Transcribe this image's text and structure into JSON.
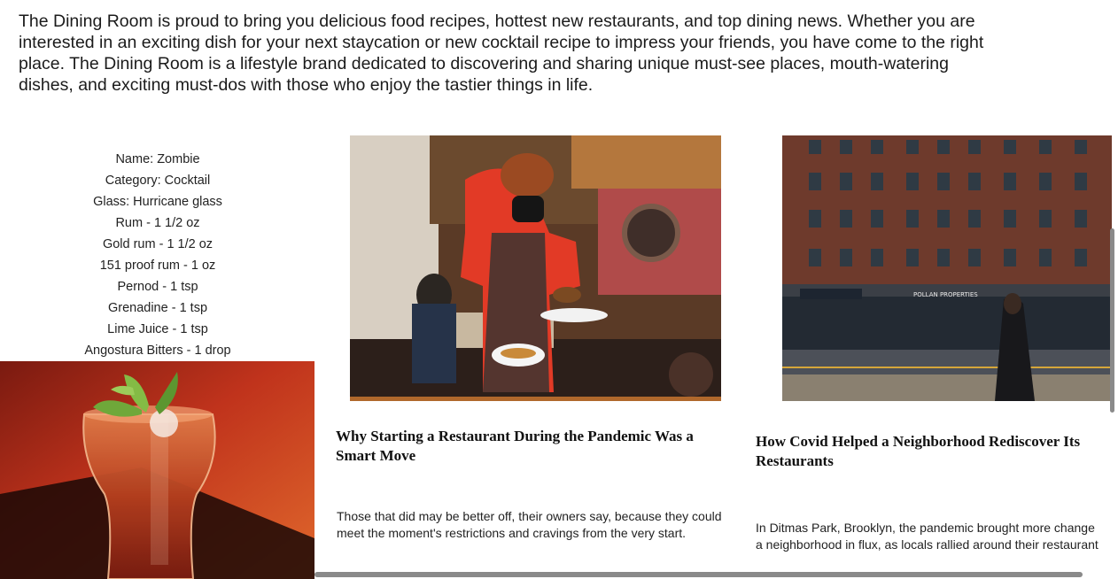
{
  "intro": {
    "text": "The Dining Room is proud to bring you delicious food recipes, hottest new restaurants, and top dining news. Whether you are interested in an exciting dish for your next staycation or new cocktail recipe to impress your friends, you have come to the right place. The Dining Room is a lifestyle brand dedicated to discovering and sharing unique must-see places, mouth-watering dishes, and exciting must-dos with those who enjoy the tastier things in life."
  },
  "recipe": {
    "name": "Name: Zombie",
    "category": "Category: Cocktail",
    "glass": "Glass: Hurricane glass",
    "ingredients": [
      "Rum - 1 1/2 oz",
      "Gold rum - 1 1/2 oz",
      "151 proof rum - 1 oz",
      "Pernod - 1 tsp",
      "Grenadine - 1 tsp",
      "Lime Juice - 1 tsp",
      "Angostura Bitters - 1 drop"
    ]
  },
  "articles": [
    {
      "headline": "Why Starting a Restaurant During the Pandemic Was a Smart Move",
      "summary": "Those that did may be better off, their owners say, because they could meet the moment's restrictions and cravings from the very start."
    },
    {
      "headline": "How Covid Helped a Neighborhood Rediscover Its Restaurants",
      "summary_line1": "In Ditmas Park, Brooklyn, the pandemic brought more change",
      "summary_line2": "a neighborhood in flux, as locals rallied around their restaurant",
      "storefront_signs": [
        "POLLAN PROPERTIES"
      ]
    }
  ],
  "colors": {
    "text": "#1b1b1b",
    "scrollbar": "#8a8a8a"
  }
}
